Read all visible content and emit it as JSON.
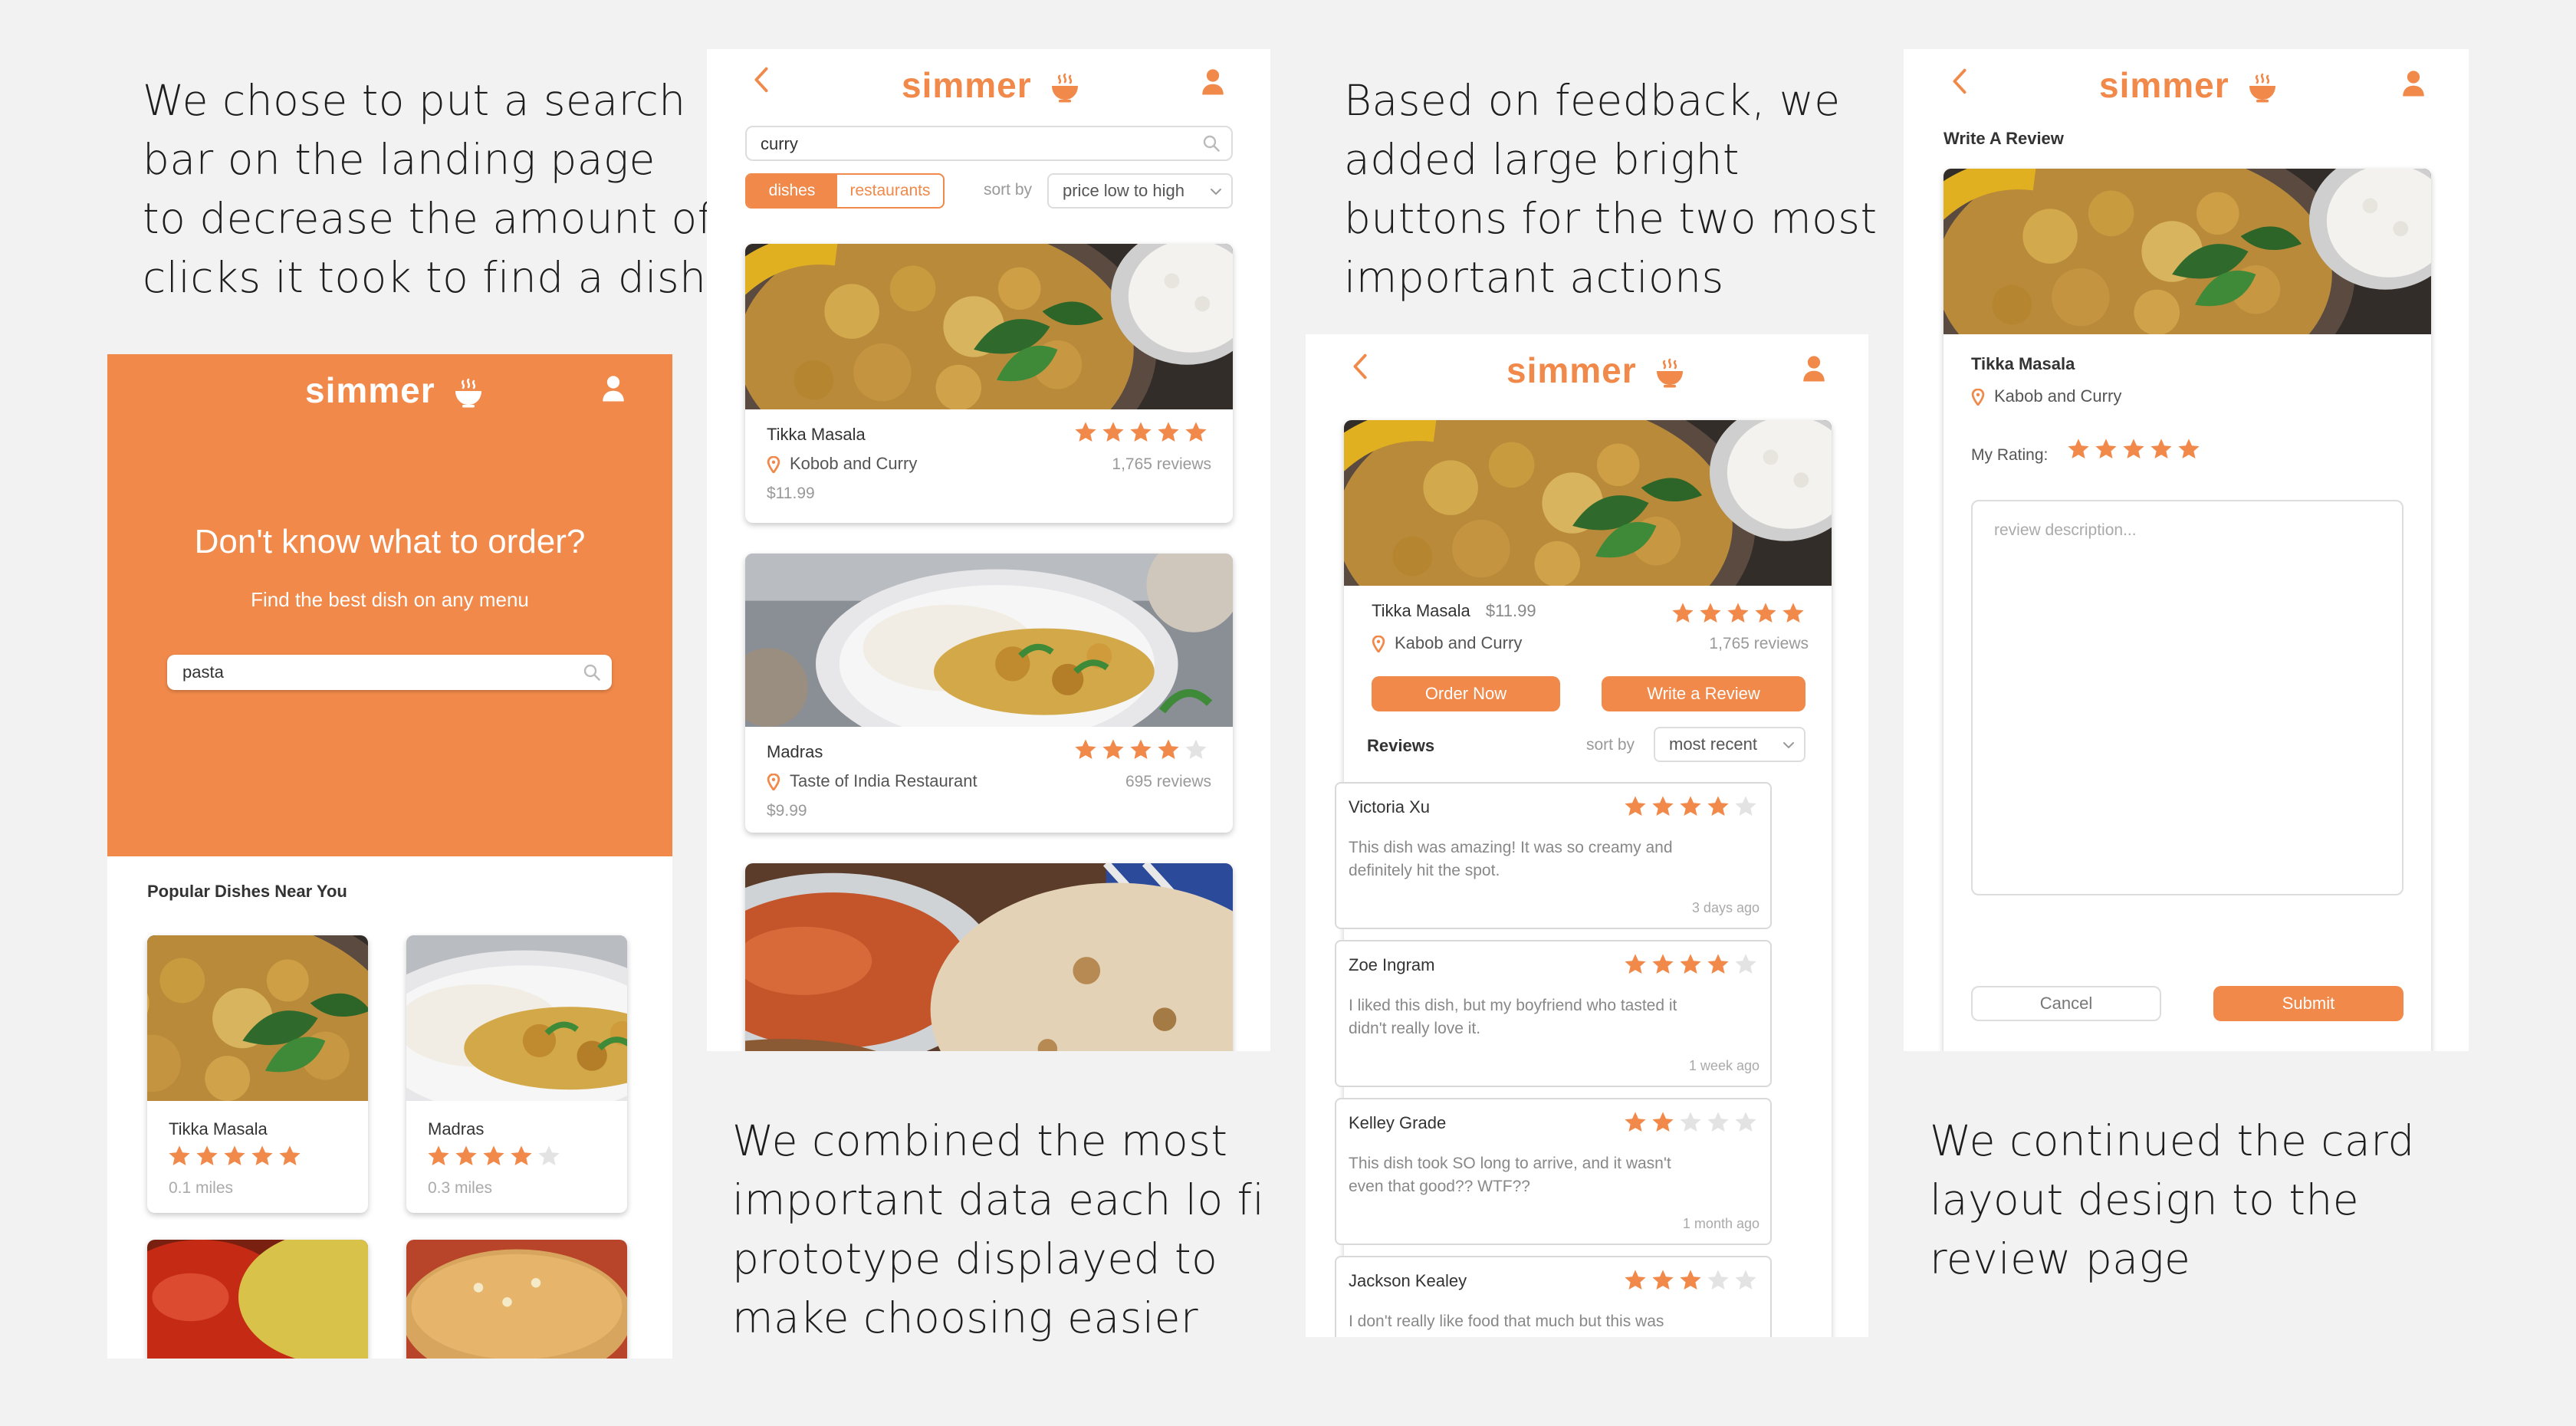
{
  "captions": {
    "c1": [
      "We chose to put a search",
      "bar on the landing page",
      "to decrease the amount of",
      "clicks it took to find a dish"
    ],
    "c2": [
      "We combined the most",
      "important data each lo fi",
      "prototype displayed to",
      "make choosing easier"
    ],
    "c3": [
      "Based on feedback, we",
      "added large bright",
      "buttons for the two most",
      "important actions"
    ],
    "c4": [
      "We continued the card",
      "layout design to the",
      "review page"
    ]
  },
  "brand": "simmer",
  "colors": {
    "accent": "#f0894a",
    "star_off": "#e3e3e3",
    "text": "#222222"
  },
  "landing": {
    "headline": "Don't know what to order?",
    "subhead": "Find the best dish on any menu",
    "search_value": "pasta",
    "section_title": "Popular Dishes Near You",
    "dishes": [
      {
        "name": "Tikka Masala",
        "rating": 5,
        "distance": "0.1 miles"
      },
      {
        "name": "Madras",
        "rating": 4,
        "distance": "0.3 miles"
      }
    ]
  },
  "results": {
    "search_value": "curry",
    "tabs": [
      "dishes",
      "restaurants"
    ],
    "active_tab": "dishes",
    "sort_label": "sort by",
    "sort_value": "price low to high",
    "items": [
      {
        "name": "Tikka Masala",
        "restaurant": "Kobob and Curry",
        "price": "$11.99",
        "rating": 5,
        "reviews": "1,765 reviews"
      },
      {
        "name": "Madras",
        "restaurant": "Taste of India Restaurant",
        "price": "$9.99",
        "rating": 4,
        "reviews": "695 reviews"
      }
    ]
  },
  "dish_page": {
    "name": "Tikka Masala",
    "price": "$11.99",
    "restaurant": "Kabob and Curry",
    "rating": 5,
    "reviews_count": "1,765 reviews",
    "order_label": "Order Now",
    "write_label": "Write a Review",
    "reviews_title": "Reviews",
    "sort_label": "sort by",
    "sort_value": "most recent",
    "reviews": [
      {
        "author": "Victoria Xu",
        "rating": 4,
        "text1": "This dish was amazing! It was so creamy and",
        "text2": "definitely hit the spot.",
        "time": "3 days ago"
      },
      {
        "author": "Zoe Ingram",
        "rating": 4,
        "text1": "I liked this dish, but my boyfriend who tasted it",
        "text2": "didn't really love it.",
        "time": "1 week ago"
      },
      {
        "author": "Kelley Grade",
        "rating": 2,
        "text1": "This dish took SO long to arrive, and it wasn't",
        "text2": "even that good?? WTF??",
        "time": "1 month ago"
      },
      {
        "author": "Jackson Kealey",
        "rating": 3,
        "text1": "I don't really like food that much but this was",
        "text2": "",
        "time": ""
      }
    ]
  },
  "write_review": {
    "title": "Write A Review",
    "dish_name": "Tikka Masala",
    "restaurant": "Kabob and Curry",
    "rating_label": "My Rating:",
    "rating": 5,
    "placeholder": "review description...",
    "cancel_label": "Cancel",
    "submit_label": "Submit"
  }
}
